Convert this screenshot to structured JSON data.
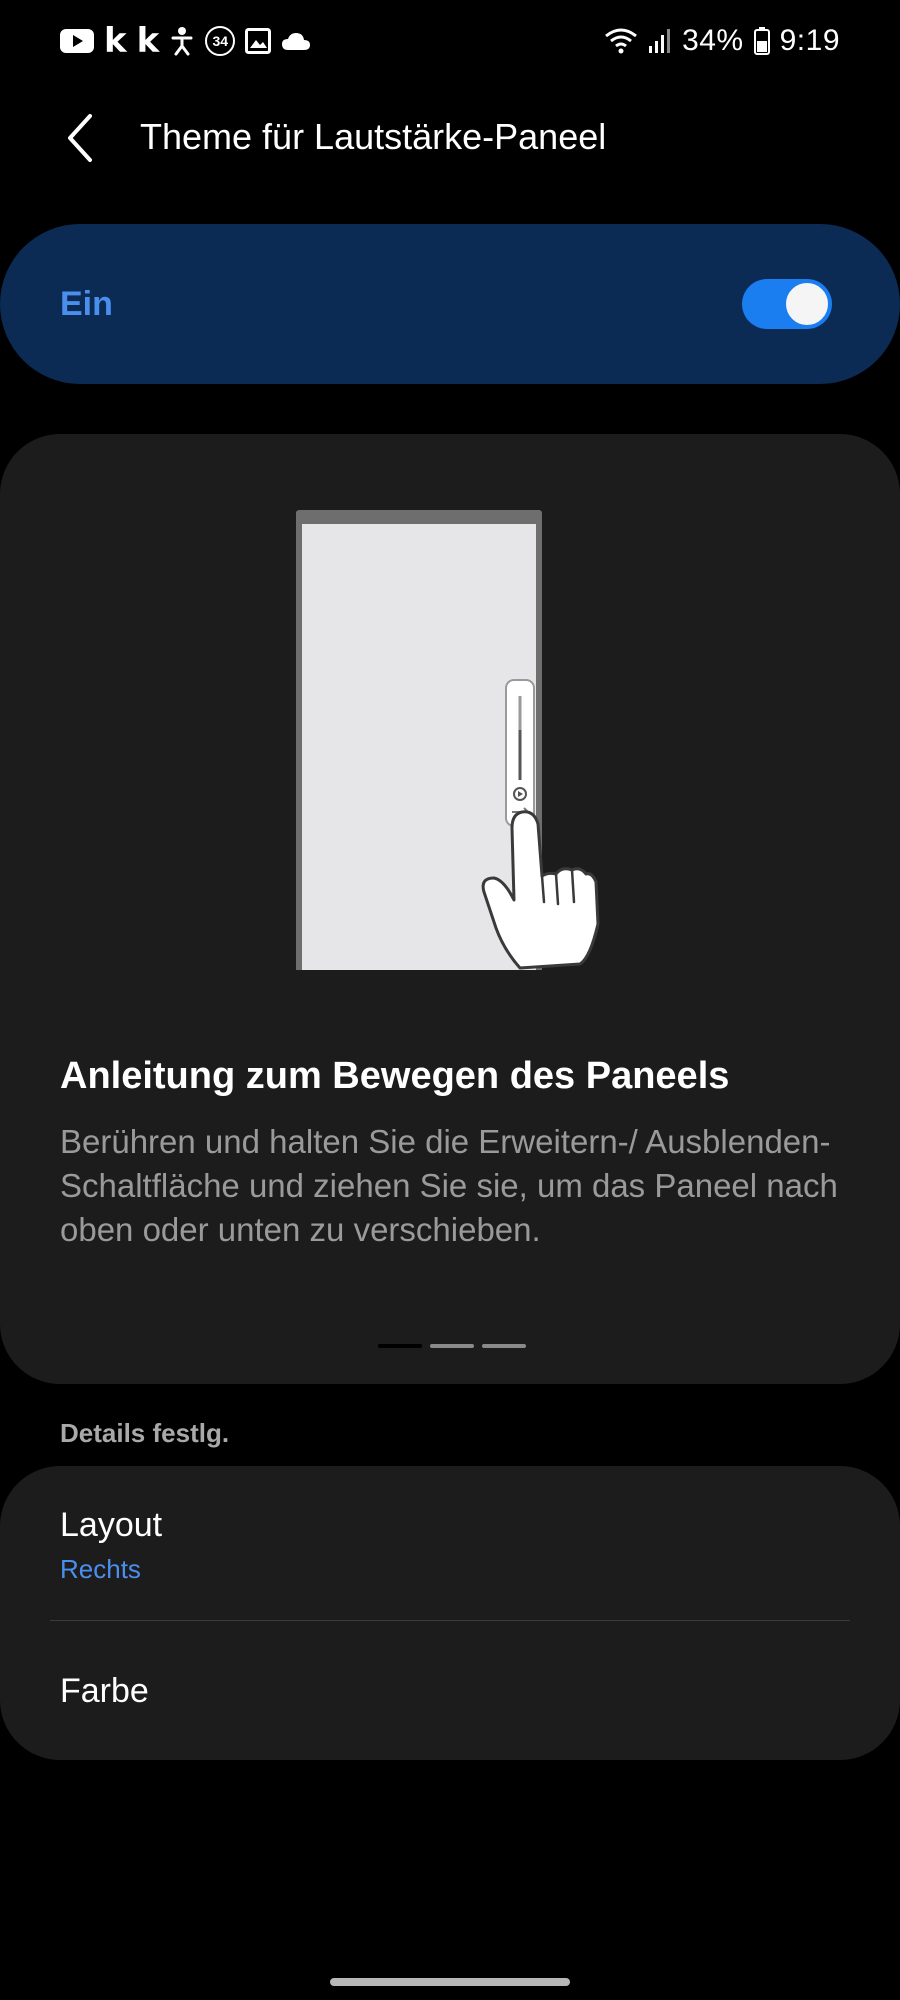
{
  "status_bar": {
    "time": "9:19",
    "battery_percent": "34%",
    "notification_badge": "34",
    "left_icons": [
      "youtube-icon",
      "k-app-icon",
      "k-app-icon",
      "accessibility-icon",
      "badge-34-icon",
      "image-icon",
      "cloud-icon"
    ],
    "right_icons": [
      "wifi-icon",
      "signal-icon",
      "battery-icon"
    ],
    "k_letter": "k"
  },
  "app_bar": {
    "title": "Theme für Lautstärke-Paneel",
    "back_icon": "back-arrow-icon"
  },
  "master_switch": {
    "label": "Ein",
    "state": "on",
    "accent_color": "#4b8fee",
    "card_color": "#0b2b55",
    "toggle_color": "#1a7df0"
  },
  "guide": {
    "title": "Anleitung zum Bewegen des Paneels",
    "description": "Berühren und halten Sie die Erweitern-/ Ausblenden-Schaltfläche und ziehen Sie sie, um das Paneel nach oben oder unten zu verschieben.",
    "page_count": 3,
    "active_page": 1
  },
  "details": {
    "section_header": "Details festlg.",
    "items": [
      {
        "title": "Layout",
        "value": "Rechts"
      },
      {
        "title": "Farbe"
      }
    ]
  }
}
